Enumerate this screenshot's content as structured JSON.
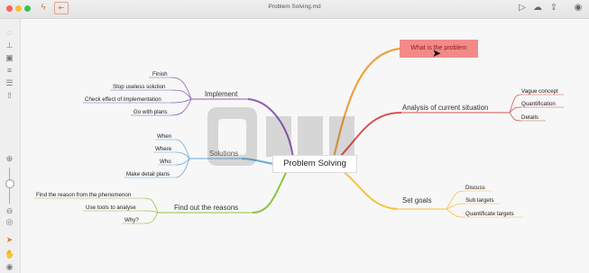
{
  "window": {
    "title": "Problem Solving.md"
  },
  "toolbar": {
    "play_icon": "play-icon",
    "share_icon": "share-icon",
    "export_icon": "export-icon",
    "user_icon": "user-icon"
  },
  "sidebar": {
    "icons": [
      "outline-icon",
      "tree-icon",
      "theme-icon",
      "structure-icon",
      "list-icon",
      "export-side-icon"
    ],
    "bottom_icons": [
      "zoom-in-icon",
      "zoom-out-icon",
      "fit-icon",
      "pointer-icon",
      "hand-icon",
      "eye-icon"
    ]
  },
  "central": {
    "label": "Problem Solving"
  },
  "branches": {
    "what_is": {
      "label": "What is the problem"
    },
    "analysis": {
      "label": "Analysis of current situation",
      "children": [
        "Vague concept",
        "Quantification",
        "Details"
      ]
    },
    "set_goals": {
      "label": "Set goals",
      "children": [
        "Discuss",
        "Sub targets",
        "Quantificate targets"
      ]
    },
    "implement": {
      "label": "Implement",
      "children": [
        "Finish",
        "Stop useless solution",
        "Check effect of implementation",
        "Go with plans"
      ]
    },
    "solutions": {
      "label": "Solutions",
      "children": [
        "When",
        "Where",
        "Who",
        "Make detail plans"
      ]
    },
    "reasons": {
      "label": "Find out the reasons",
      "children": [
        "Find the reason from the phenomenon",
        "Use tools to analyse",
        "Why?"
      ]
    }
  },
  "colors": {
    "orange": "#f0a040",
    "red": "#d9534f",
    "yellow": "#f5c242",
    "purple": "#8e5bb5",
    "blue": "#6aaad6",
    "green": "#8cc63f"
  }
}
